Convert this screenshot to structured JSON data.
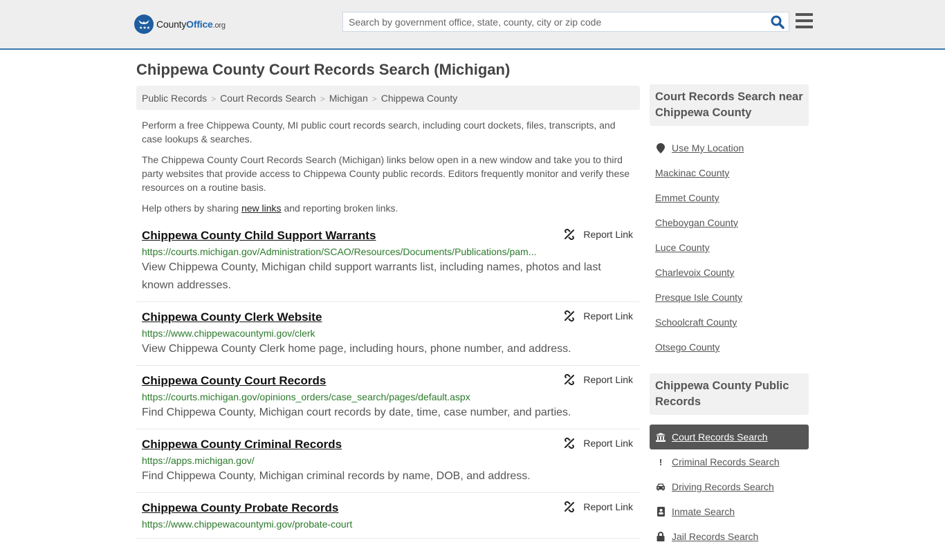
{
  "header": {
    "logo": {
      "icon": "eagle-stars-badge-icon",
      "name_prefix": "County",
      "name_brand": "Office",
      "name_tld": ".org"
    },
    "search": {
      "placeholder": "Search by government office, state, county, city or zip code",
      "value": "",
      "icon": "search-icon"
    },
    "menu_icon": "hamburger-menu-icon"
  },
  "page": {
    "title": "Chippewa County Court Records Search (Michigan)"
  },
  "breadcrumb": [
    "Public Records",
    "Court Records Search",
    "Michigan",
    "Chippewa County"
  ],
  "intro": {
    "p1": "Perform a free Chippewa County, MI public court records search, including court dockets, files, transcripts, and case lookups & searches.",
    "p2": "The Chippewa County Court Records Search (Michigan) links below open in a new window and take you to third party websites that provide access to Chippewa County public records. Editors frequently monitor and verify these resources on a routine basis.",
    "p3_before": "Help others by sharing ",
    "p3_link": "new links",
    "p3_after": " and reporting broken links."
  },
  "report_label": "Report Link",
  "results": [
    {
      "title": "Chippewa County Child Support Warrants",
      "url": "https://courts.michigan.gov/Administration/SCAO/Resources/Documents/Publications/pam...",
      "desc": "View Chippewa County, Michigan child support warrants list, including names, photos and last known addresses."
    },
    {
      "title": "Chippewa County Clerk Website",
      "url": "https://www.chippewacountymi.gov/clerk",
      "desc": "View Chippewa County Clerk home page, including hours, phone number, and address."
    },
    {
      "title": "Chippewa County Court Records",
      "url": "https://courts.michigan.gov/opinions_orders/case_search/pages/default.aspx",
      "desc": "Find Chippewa County, Michigan court records by date, time, case number, and parties."
    },
    {
      "title": "Chippewa County Criminal Records",
      "url": "https://apps.michigan.gov/",
      "desc": "Find Chippewa County, Michigan criminal records by name, DOB, and address."
    },
    {
      "title": "Chippewa County Probate Records",
      "url": "https://www.chippewacountymi.gov/probate-court",
      "desc": ""
    }
  ],
  "sidebar": {
    "nearby_heading": "Court Records Search near Chippewa County",
    "use_location": "Use My Location",
    "nearby": [
      "Mackinac County",
      "Emmet County",
      "Cheboygan County",
      "Luce County",
      "Charlevoix County",
      "Presque Isle County",
      "Schoolcraft County",
      "Otsego County"
    ],
    "public_heading": "Chippewa County Public Records",
    "public_links": [
      {
        "label": "Court Records Search",
        "icon": "courthouse-icon",
        "glyph": "🏛",
        "active": true
      },
      {
        "label": "Criminal Records Search",
        "icon": "exclamation-icon",
        "glyph": "!",
        "active": false
      },
      {
        "label": "Driving Records Search",
        "icon": "car-icon",
        "glyph": "🚘",
        "active": false
      },
      {
        "label": "Inmate Search",
        "icon": "id-badge-icon",
        "glyph": "▣",
        "active": false
      },
      {
        "label": "Jail Records Search",
        "icon": "lock-icon",
        "glyph": "🔒",
        "active": false
      }
    ]
  }
}
